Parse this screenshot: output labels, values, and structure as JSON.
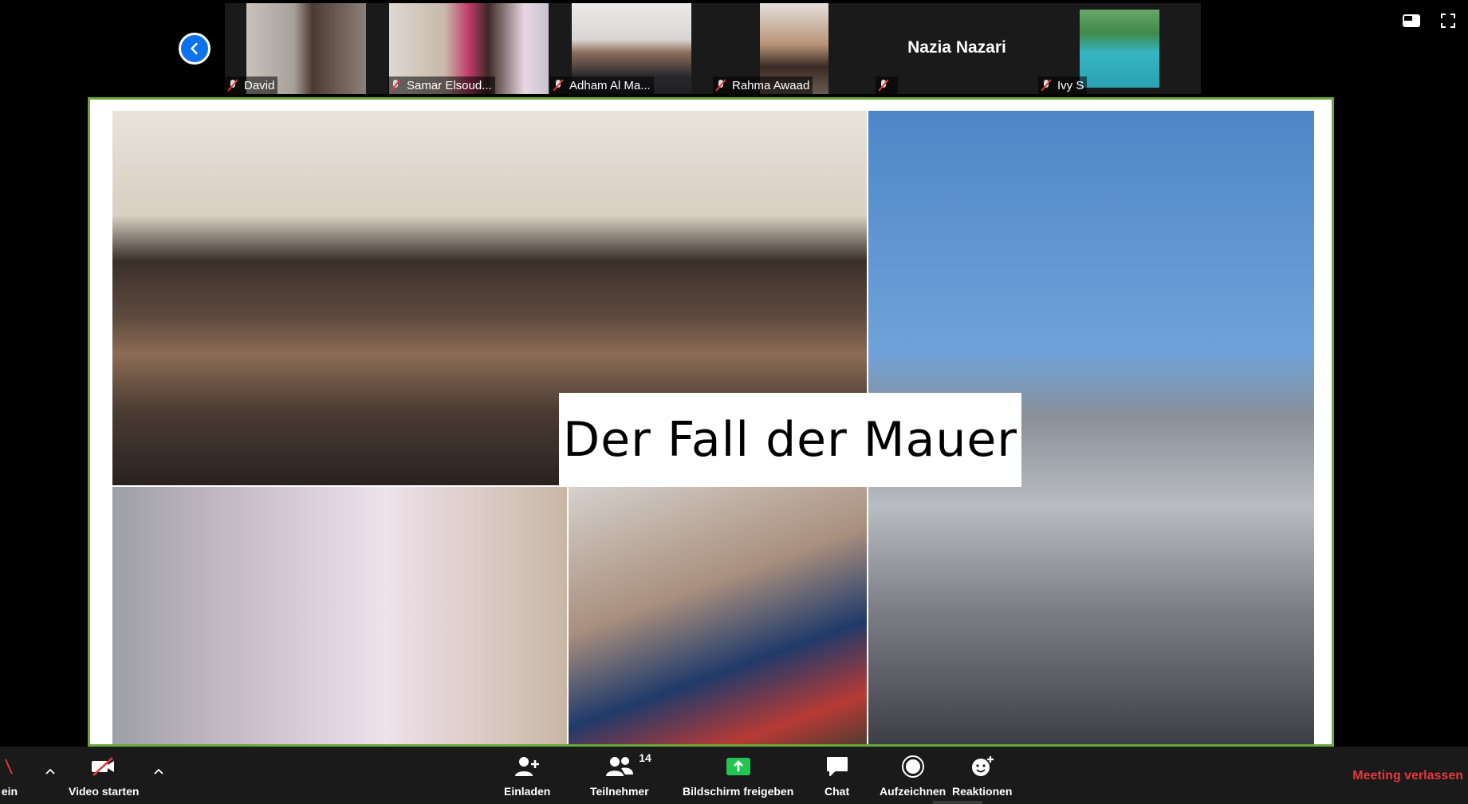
{
  "gallery": {
    "participants": [
      {
        "name": "David",
        "muted": true
      },
      {
        "name": "Samar Elsoud...",
        "muted": true
      },
      {
        "name": "Adham Al Ma...",
        "muted": true
      },
      {
        "name": "Rahma Awaad",
        "muted": true
      },
      {
        "name": "",
        "center_name": "Nazia Nazari",
        "muted": true
      },
      {
        "name": "Ivy S",
        "muted": true
      }
    ]
  },
  "slide": {
    "title": "Der Fall der Mauer"
  },
  "toolbar": {
    "audio_label": "ein",
    "video_label": "Video starten",
    "invite_label": "Einladen",
    "participants_label": "Teilnehmer",
    "participants_count": "14",
    "share_label": "Bildschirm freigeben",
    "chat_label": "Chat",
    "record_label": "Aufzeichnen",
    "reactions_label": "Reaktionen",
    "leave_label": "Meeting verlassen"
  },
  "colors": {
    "accent_blue": "#0e72ed",
    "share_green": "#23c552",
    "leave_red": "#e5383b",
    "slide_border": "#6aa73a"
  },
  "icons": [
    "chevron-left-icon",
    "view-icon",
    "fullscreen-icon",
    "mic-muted-icon",
    "video-off-icon",
    "add-user-icon",
    "participants-icon",
    "share-screen-icon",
    "chat-icon",
    "record-icon",
    "reactions-icon"
  ]
}
